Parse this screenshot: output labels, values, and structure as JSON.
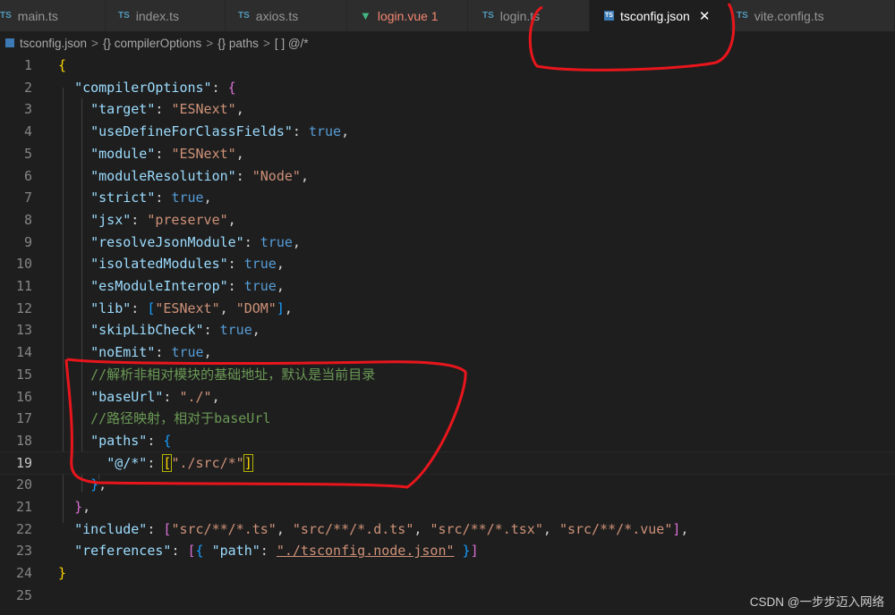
{
  "tabs": [
    {
      "label": "main.ts",
      "icon": "TS",
      "active": false
    },
    {
      "label": "index.ts",
      "icon": "TS",
      "active": false
    },
    {
      "label": "axios.ts",
      "icon": "TS",
      "active": false
    },
    {
      "label": "login.vue 1",
      "icon": "vue-icon",
      "active": false
    },
    {
      "label": "login.ts",
      "icon": "TS",
      "active": false
    },
    {
      "label": "tsconfig.json",
      "icon": "json-icon",
      "active": true
    },
    {
      "label": "vite.config.ts",
      "icon": "TS",
      "active": false
    }
  ],
  "close_symbol": "✕",
  "breadcrumb": {
    "file": "tsconfig.json",
    "items": [
      "{} compilerOptions",
      "{} paths",
      "[ ] @/*"
    ],
    "separator": ">"
  },
  "current_line": 19,
  "lines": [
    {
      "n": "1"
    },
    {
      "n": "2"
    },
    {
      "n": "3"
    },
    {
      "n": "4"
    },
    {
      "n": "5"
    },
    {
      "n": "6"
    },
    {
      "n": "7"
    },
    {
      "n": "8"
    },
    {
      "n": "9"
    },
    {
      "n": "10"
    },
    {
      "n": "11"
    },
    {
      "n": "12"
    },
    {
      "n": "13"
    },
    {
      "n": "14"
    },
    {
      "n": "15"
    },
    {
      "n": "16"
    },
    {
      "n": "17"
    },
    {
      "n": "18"
    },
    {
      "n": "19"
    },
    {
      "n": "20"
    },
    {
      "n": "21"
    },
    {
      "n": "22"
    },
    {
      "n": "23"
    },
    {
      "n": "24"
    },
    {
      "n": "25"
    }
  ],
  "code": {
    "open_brace": "{",
    "close_brace": "}",
    "colon": ": ",
    "comma": ",",
    "compilerOptions_key": "\"compilerOptions\"",
    "target_key": "\"target\"",
    "target_val": "\"ESNext\"",
    "useDefine_key": "\"useDefineForClassFields\"",
    "true": "true",
    "module_key": "\"module\"",
    "module_val": "\"ESNext\"",
    "moduleResolution_key": "\"moduleResolution\"",
    "moduleResolution_val": "\"Node\"",
    "strict_key": "\"strict\"",
    "jsx_key": "\"jsx\"",
    "jsx_val": "\"preserve\"",
    "resolveJson_key": "\"resolveJsonModule\"",
    "isolated_key": "\"isolatedModules\"",
    "esModule_key": "\"esModuleInterop\"",
    "lib_key": "\"lib\"",
    "lib_v1": "\"ESNext\"",
    "lib_v2": "\"DOM\"",
    "skipLib_key": "\"skipLibCheck\"",
    "noEmit_key": "\"noEmit\"",
    "comment1": "//解析非相对模块的基础地址，默认是当前目录",
    "baseUrl_key": "\"baseUrl\"",
    "baseUrl_val": "\"./\"",
    "comment2": "//路径映射，相对于baseUrl",
    "paths_key": "\"paths\"",
    "alias_key": "\"@/*\"",
    "alias_val": "\"./src/*\"",
    "include_key": "\"include\"",
    "include_v1": "\"src/**/*.ts\"",
    "include_v2": "\"src/**/*.d.ts\"",
    "include_v3": "\"src/**/*.tsx\"",
    "include_v4": "\"src/**/*.vue\"",
    "references_key": "\"references\"",
    "path_key": "\"path\"",
    "path_val": "\"./tsconfig.node.json\""
  },
  "watermark": "CSDN @一步步迈入网络",
  "colors": {
    "key": "#9cdcfe",
    "string": "#ce9178",
    "boolean": "#569cd6",
    "comment": "#6a9955",
    "annotation": "#e8161c"
  }
}
